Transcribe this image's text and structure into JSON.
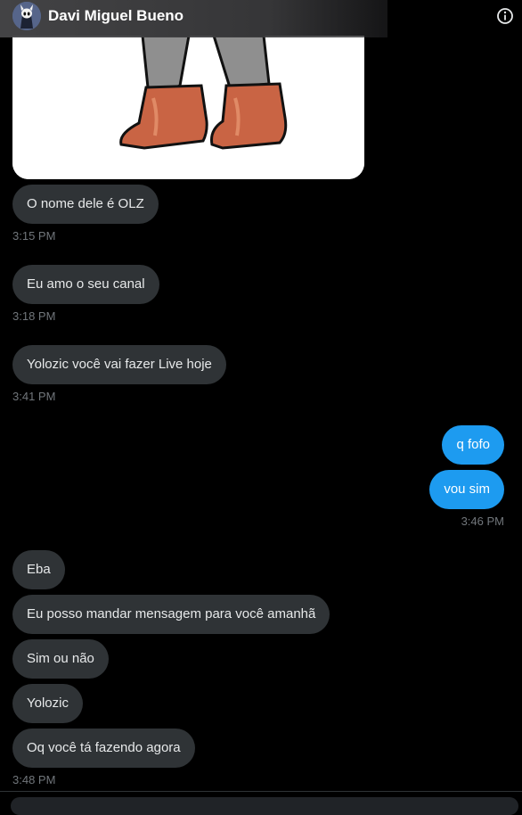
{
  "header": {
    "contact_name": "Davi Miguel Bueno",
    "info_icon": "info-icon"
  },
  "messages": [
    {
      "dir": "in",
      "text": "O nome dele é OLZ"
    },
    {
      "dir": "in",
      "text": "Eu amo o seu canal"
    },
    {
      "dir": "in",
      "text": "Yolozic você vai fazer Live hoje"
    },
    {
      "dir": "out",
      "text": "q fofo"
    },
    {
      "dir": "out",
      "text": "vou sim"
    },
    {
      "dir": "in",
      "text": "Eba"
    },
    {
      "dir": "in",
      "text": "Eu posso mandar mensagem para você amanhã"
    },
    {
      "dir": "in",
      "text": "Sim ou não"
    },
    {
      "dir": "in",
      "text": "Yolozic"
    },
    {
      "dir": "in",
      "text": "Oq você tá fazendo agora"
    }
  ],
  "timestamps": [
    "3:15 PM",
    "3:18 PM",
    "3:41 PM",
    "3:46 PM",
    "3:48 PM"
  ],
  "colors": {
    "incoming_bubble": "#2f3336",
    "outgoing_bubble": "#1d9bf0",
    "background": "#000000",
    "timestamp": "#71767b"
  }
}
